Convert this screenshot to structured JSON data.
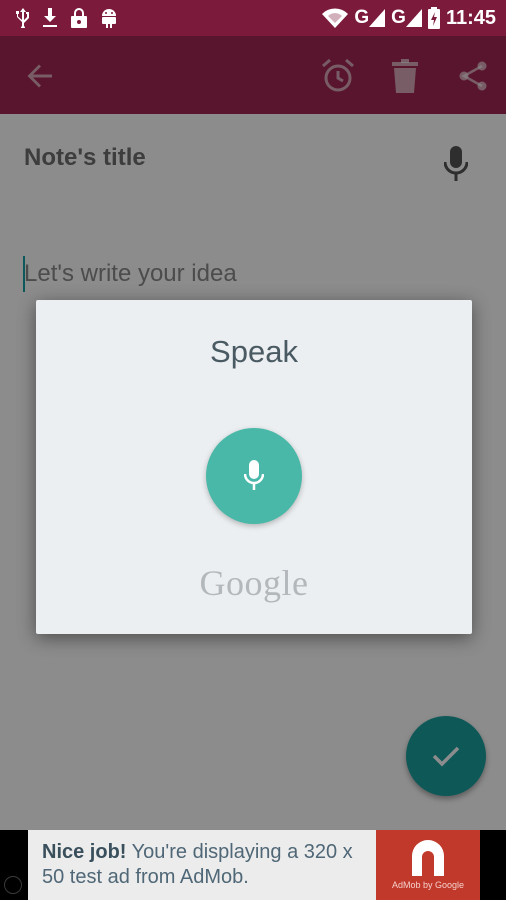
{
  "status_bar": {
    "time": "11:45",
    "network_1": "G",
    "network_2": "G",
    "left_icons": [
      "usb-icon",
      "download-icon",
      "lock-icon",
      "android-debug-icon"
    ],
    "right_icons": [
      "wifi-icon",
      "signal-icon",
      "signal-icon",
      "battery-charging-icon"
    ]
  },
  "toolbar": {
    "icons": [
      "back-arrow-icon",
      "alarm-clock-icon",
      "trash-icon",
      "share-icon"
    ],
    "color": "#a22753"
  },
  "note": {
    "title_placeholder": "Note's title",
    "body_placeholder": "Let's write your idea"
  },
  "dialog": {
    "title": "Speak",
    "brand": "Google",
    "accent": "#4ab8a8"
  },
  "fab": {
    "icon": "check-icon",
    "color": "#1aa0a0"
  },
  "ad": {
    "headline": "Nice job!",
    "message": "You're displaying a 320 x 50 test ad from AdMob.",
    "logo_caption": "AdMob by Google"
  }
}
